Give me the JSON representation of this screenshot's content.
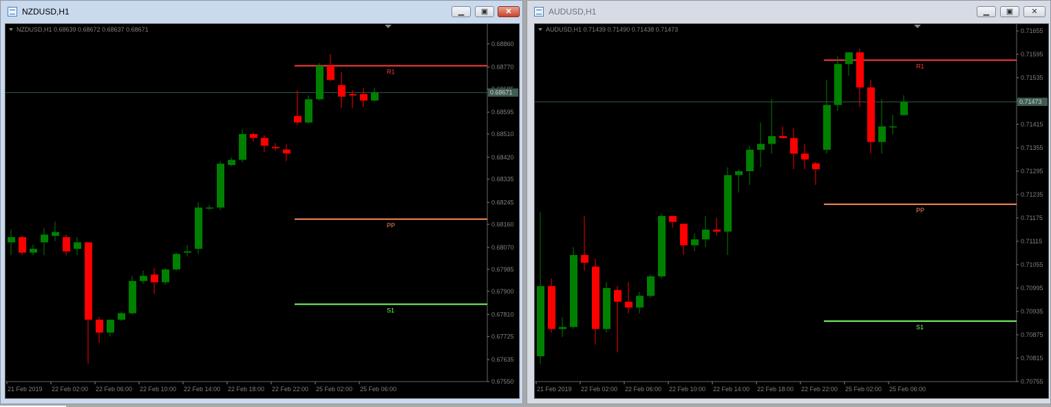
{
  "windows": [
    {
      "title": "NZDUSD,H1",
      "active": true,
      "buttons": {
        "minimize": "▁",
        "maximize": "▣",
        "close": "✕"
      },
      "info": "NZDUSD,H1  0.68639 0.68672 0.68637 0.68671"
    },
    {
      "title": "AUDUSD,H1",
      "active": false,
      "buttons": {
        "minimize": "▁",
        "maximize": "▣",
        "close": "✕"
      },
      "info": "AUDUSD,H1  0.71439 0.71490 0.71438 0.71473"
    }
  ],
  "colors": {
    "background": "#000000",
    "bull": "#008000",
    "bear": "#ff0000",
    "grid_text": "#808080",
    "r1": "#ff3c3c",
    "pp": "#ff8c5a",
    "s1": "#78ff64",
    "price_line": "#335c4a"
  },
  "chart_data": [
    {
      "type": "candlestick",
      "symbol": "NZDUSD",
      "timeframe": "H1",
      "ylim": [
        0.6755,
        0.6891
      ],
      "y_ticks": [
        "0.68860",
        "0.68770",
        "0.68685",
        "0.68595",
        "0.68510",
        "0.68420",
        "0.68335",
        "0.68245",
        "0.68160",
        "0.68070",
        "0.67985",
        "0.67900",
        "0.67810",
        "0.67725",
        "0.67635",
        "0.67550"
      ],
      "x_labels": [
        "21 Feb 2019",
        "22 Feb 02:00",
        "22 Feb 06:00",
        "22 Feb 10:00",
        "22 Feb 14:00",
        "22 Feb 18:00",
        "22 Feb 22:00",
        "25 Feb 02:00",
        "25 Feb 06:00"
      ],
      "current_price": "0.68671",
      "candles": [
        {
          "o": 0.6809,
          "h": 0.6814,
          "l": 0.6804,
          "c": 0.6811
        },
        {
          "o": 0.6811,
          "h": 0.68115,
          "l": 0.6804,
          "c": 0.6805
        },
        {
          "o": 0.6805,
          "h": 0.6808,
          "l": 0.6804,
          "c": 0.68065
        },
        {
          "o": 0.6809,
          "h": 0.68145,
          "l": 0.6804,
          "c": 0.6812
        },
        {
          "o": 0.68115,
          "h": 0.6817,
          "l": 0.68095,
          "c": 0.6813
        },
        {
          "o": 0.6811,
          "h": 0.6812,
          "l": 0.6804,
          "c": 0.68055
        },
        {
          "o": 0.68065,
          "h": 0.6811,
          "l": 0.6804,
          "c": 0.6809
        },
        {
          "o": 0.6809,
          "h": 0.6809,
          "l": 0.6762,
          "c": 0.6779
        },
        {
          "o": 0.6779,
          "h": 0.678,
          "l": 0.677,
          "c": 0.6774
        },
        {
          "o": 0.6774,
          "h": 0.6779,
          "l": 0.67725,
          "c": 0.6779
        },
        {
          "o": 0.6779,
          "h": 0.6782,
          "l": 0.67785,
          "c": 0.67815
        },
        {
          "o": 0.67815,
          "h": 0.6796,
          "l": 0.6781,
          "c": 0.6794
        },
        {
          "o": 0.6794,
          "h": 0.6798,
          "l": 0.6793,
          "c": 0.6796
        },
        {
          "o": 0.67965,
          "h": 0.6799,
          "l": 0.6789,
          "c": 0.67935
        },
        {
          "o": 0.67935,
          "h": 0.6799,
          "l": 0.67925,
          "c": 0.67985
        },
        {
          "o": 0.67985,
          "h": 0.6805,
          "l": 0.6798,
          "c": 0.68045
        },
        {
          "o": 0.6805,
          "h": 0.6808,
          "l": 0.68035,
          "c": 0.68055
        },
        {
          "o": 0.68065,
          "h": 0.68245,
          "l": 0.68045,
          "c": 0.68225
        },
        {
          "o": 0.68225,
          "h": 0.68235,
          "l": 0.68215,
          "c": 0.68225
        },
        {
          "o": 0.68225,
          "h": 0.68405,
          "l": 0.68215,
          "c": 0.68395
        },
        {
          "o": 0.6839,
          "h": 0.6842,
          "l": 0.68385,
          "c": 0.6841
        },
        {
          "o": 0.6841,
          "h": 0.6853,
          "l": 0.684,
          "c": 0.6851
        },
        {
          "o": 0.6851,
          "h": 0.68515,
          "l": 0.6848,
          "c": 0.68495
        },
        {
          "o": 0.68495,
          "h": 0.68505,
          "l": 0.6844,
          "c": 0.68465
        },
        {
          "o": 0.6846,
          "h": 0.68475,
          "l": 0.68445,
          "c": 0.68455
        },
        {
          "o": 0.6845,
          "h": 0.6847,
          "l": 0.68405,
          "c": 0.68435
        },
        {
          "o": 0.6858,
          "h": 0.6868,
          "l": 0.68545,
          "c": 0.68555
        },
        {
          "o": 0.68555,
          "h": 0.6866,
          "l": 0.6855,
          "c": 0.68645
        },
        {
          "o": 0.68645,
          "h": 0.68785,
          "l": 0.6864,
          "c": 0.68775
        },
        {
          "o": 0.68775,
          "h": 0.6882,
          "l": 0.68715,
          "c": 0.6872
        },
        {
          "o": 0.687,
          "h": 0.6875,
          "l": 0.6861,
          "c": 0.68655
        },
        {
          "o": 0.68665,
          "h": 0.6868,
          "l": 0.6861,
          "c": 0.6866
        },
        {
          "o": 0.68665,
          "h": 0.6869,
          "l": 0.68615,
          "c": 0.6864
        },
        {
          "o": 0.6864,
          "h": 0.6869,
          "l": 0.68637,
          "c": 0.68671
        }
      ],
      "pivots": [
        {
          "label": "R1",
          "value": 0.68775
        },
        {
          "label": "PP",
          "value": 0.6818
        },
        {
          "label": "S1",
          "value": 0.6785
        }
      ],
      "pivot_start_index": 26
    },
    {
      "type": "candlestick",
      "symbol": "AUDUSD",
      "timeframe": "H1",
      "ylim": [
        0.70755,
        0.71655
      ],
      "y_ticks": [
        "0.71655",
        "0.71595",
        "0.71535",
        "0.71475",
        "0.71415",
        "0.71355",
        "0.71295",
        "0.71235",
        "0.71175",
        "0.71115",
        "0.71055",
        "0.70995",
        "0.70935",
        "0.70875",
        "0.70815",
        "0.70755"
      ],
      "x_labels": [
        "21 Feb 2019",
        "22 Feb 02:00",
        "22 Feb 06:00",
        "22 Feb 10:00",
        "22 Feb 14:00",
        "22 Feb 18:00",
        "22 Feb 22:00",
        "25 Feb 02:00",
        "25 Feb 06:00"
      ],
      "current_price": "0.71473",
      "candles": [
        {
          "o": 0.7082,
          "h": 0.7119,
          "l": 0.708,
          "c": 0.71
        },
        {
          "o": 0.71,
          "h": 0.7102,
          "l": 0.7088,
          "c": 0.7089
        },
        {
          "o": 0.7089,
          "h": 0.7092,
          "l": 0.7087,
          "c": 0.70895
        },
        {
          "o": 0.70895,
          "h": 0.711,
          "l": 0.7089,
          "c": 0.7108
        },
        {
          "o": 0.7108,
          "h": 0.7118,
          "l": 0.7104,
          "c": 0.7106
        },
        {
          "o": 0.7105,
          "h": 0.7107,
          "l": 0.7085,
          "c": 0.7089
        },
        {
          "o": 0.7089,
          "h": 0.7101,
          "l": 0.7088,
          "c": 0.70995
        },
        {
          "o": 0.7099,
          "h": 0.71,
          "l": 0.7083,
          "c": 0.7096
        },
        {
          "o": 0.7096,
          "h": 0.7101,
          "l": 0.7093,
          "c": 0.70945
        },
        {
          "o": 0.70945,
          "h": 0.70985,
          "l": 0.7093,
          "c": 0.70975
        },
        {
          "o": 0.70975,
          "h": 0.7103,
          "l": 0.7097,
          "c": 0.71025
        },
        {
          "o": 0.71025,
          "h": 0.71185,
          "l": 0.7102,
          "c": 0.7118
        },
        {
          "o": 0.7118,
          "h": 0.7118,
          "l": 0.7115,
          "c": 0.71165
        },
        {
          "o": 0.7116,
          "h": 0.7116,
          "l": 0.7108,
          "c": 0.71105
        },
        {
          "o": 0.71105,
          "h": 0.71135,
          "l": 0.7109,
          "c": 0.7112
        },
        {
          "o": 0.7112,
          "h": 0.7118,
          "l": 0.711,
          "c": 0.71145
        },
        {
          "o": 0.71145,
          "h": 0.71175,
          "l": 0.7113,
          "c": 0.7114
        },
        {
          "o": 0.7114,
          "h": 0.71305,
          "l": 0.7108,
          "c": 0.71285
        },
        {
          "o": 0.71285,
          "h": 0.713,
          "l": 0.7124,
          "c": 0.71295
        },
        {
          "o": 0.71295,
          "h": 0.7136,
          "l": 0.7126,
          "c": 0.7135
        },
        {
          "o": 0.7135,
          "h": 0.7142,
          "l": 0.71305,
          "c": 0.71365
        },
        {
          "o": 0.71365,
          "h": 0.7148,
          "l": 0.7134,
          "c": 0.71385
        },
        {
          "o": 0.71385,
          "h": 0.7141,
          "l": 0.7138,
          "c": 0.7138
        },
        {
          "o": 0.7138,
          "h": 0.71405,
          "l": 0.713,
          "c": 0.7134
        },
        {
          "o": 0.7134,
          "h": 0.71365,
          "l": 0.713,
          "c": 0.71325
        },
        {
          "o": 0.71315,
          "h": 0.7132,
          "l": 0.7126,
          "c": 0.713
        },
        {
          "o": 0.7135,
          "h": 0.7153,
          "l": 0.7134,
          "c": 0.71465
        },
        {
          "o": 0.71465,
          "h": 0.7159,
          "l": 0.7145,
          "c": 0.7157
        },
        {
          "o": 0.7157,
          "h": 0.716,
          "l": 0.7154,
          "c": 0.716
        },
        {
          "o": 0.716,
          "h": 0.7161,
          "l": 0.7146,
          "c": 0.7151
        },
        {
          "o": 0.7151,
          "h": 0.7153,
          "l": 0.7134,
          "c": 0.7137
        },
        {
          "o": 0.7137,
          "h": 0.7148,
          "l": 0.7134,
          "c": 0.7141
        },
        {
          "o": 0.7141,
          "h": 0.7144,
          "l": 0.7139,
          "c": 0.7141
        },
        {
          "o": 0.71439,
          "h": 0.7149,
          "l": 0.71438,
          "c": 0.71473
        }
      ],
      "pivots": [
        {
          "label": "R1",
          "value": 0.7158
        },
        {
          "label": "PP",
          "value": 0.7121
        },
        {
          "label": "S1",
          "value": 0.7091
        }
      ],
      "pivot_start_index": 26
    }
  ]
}
